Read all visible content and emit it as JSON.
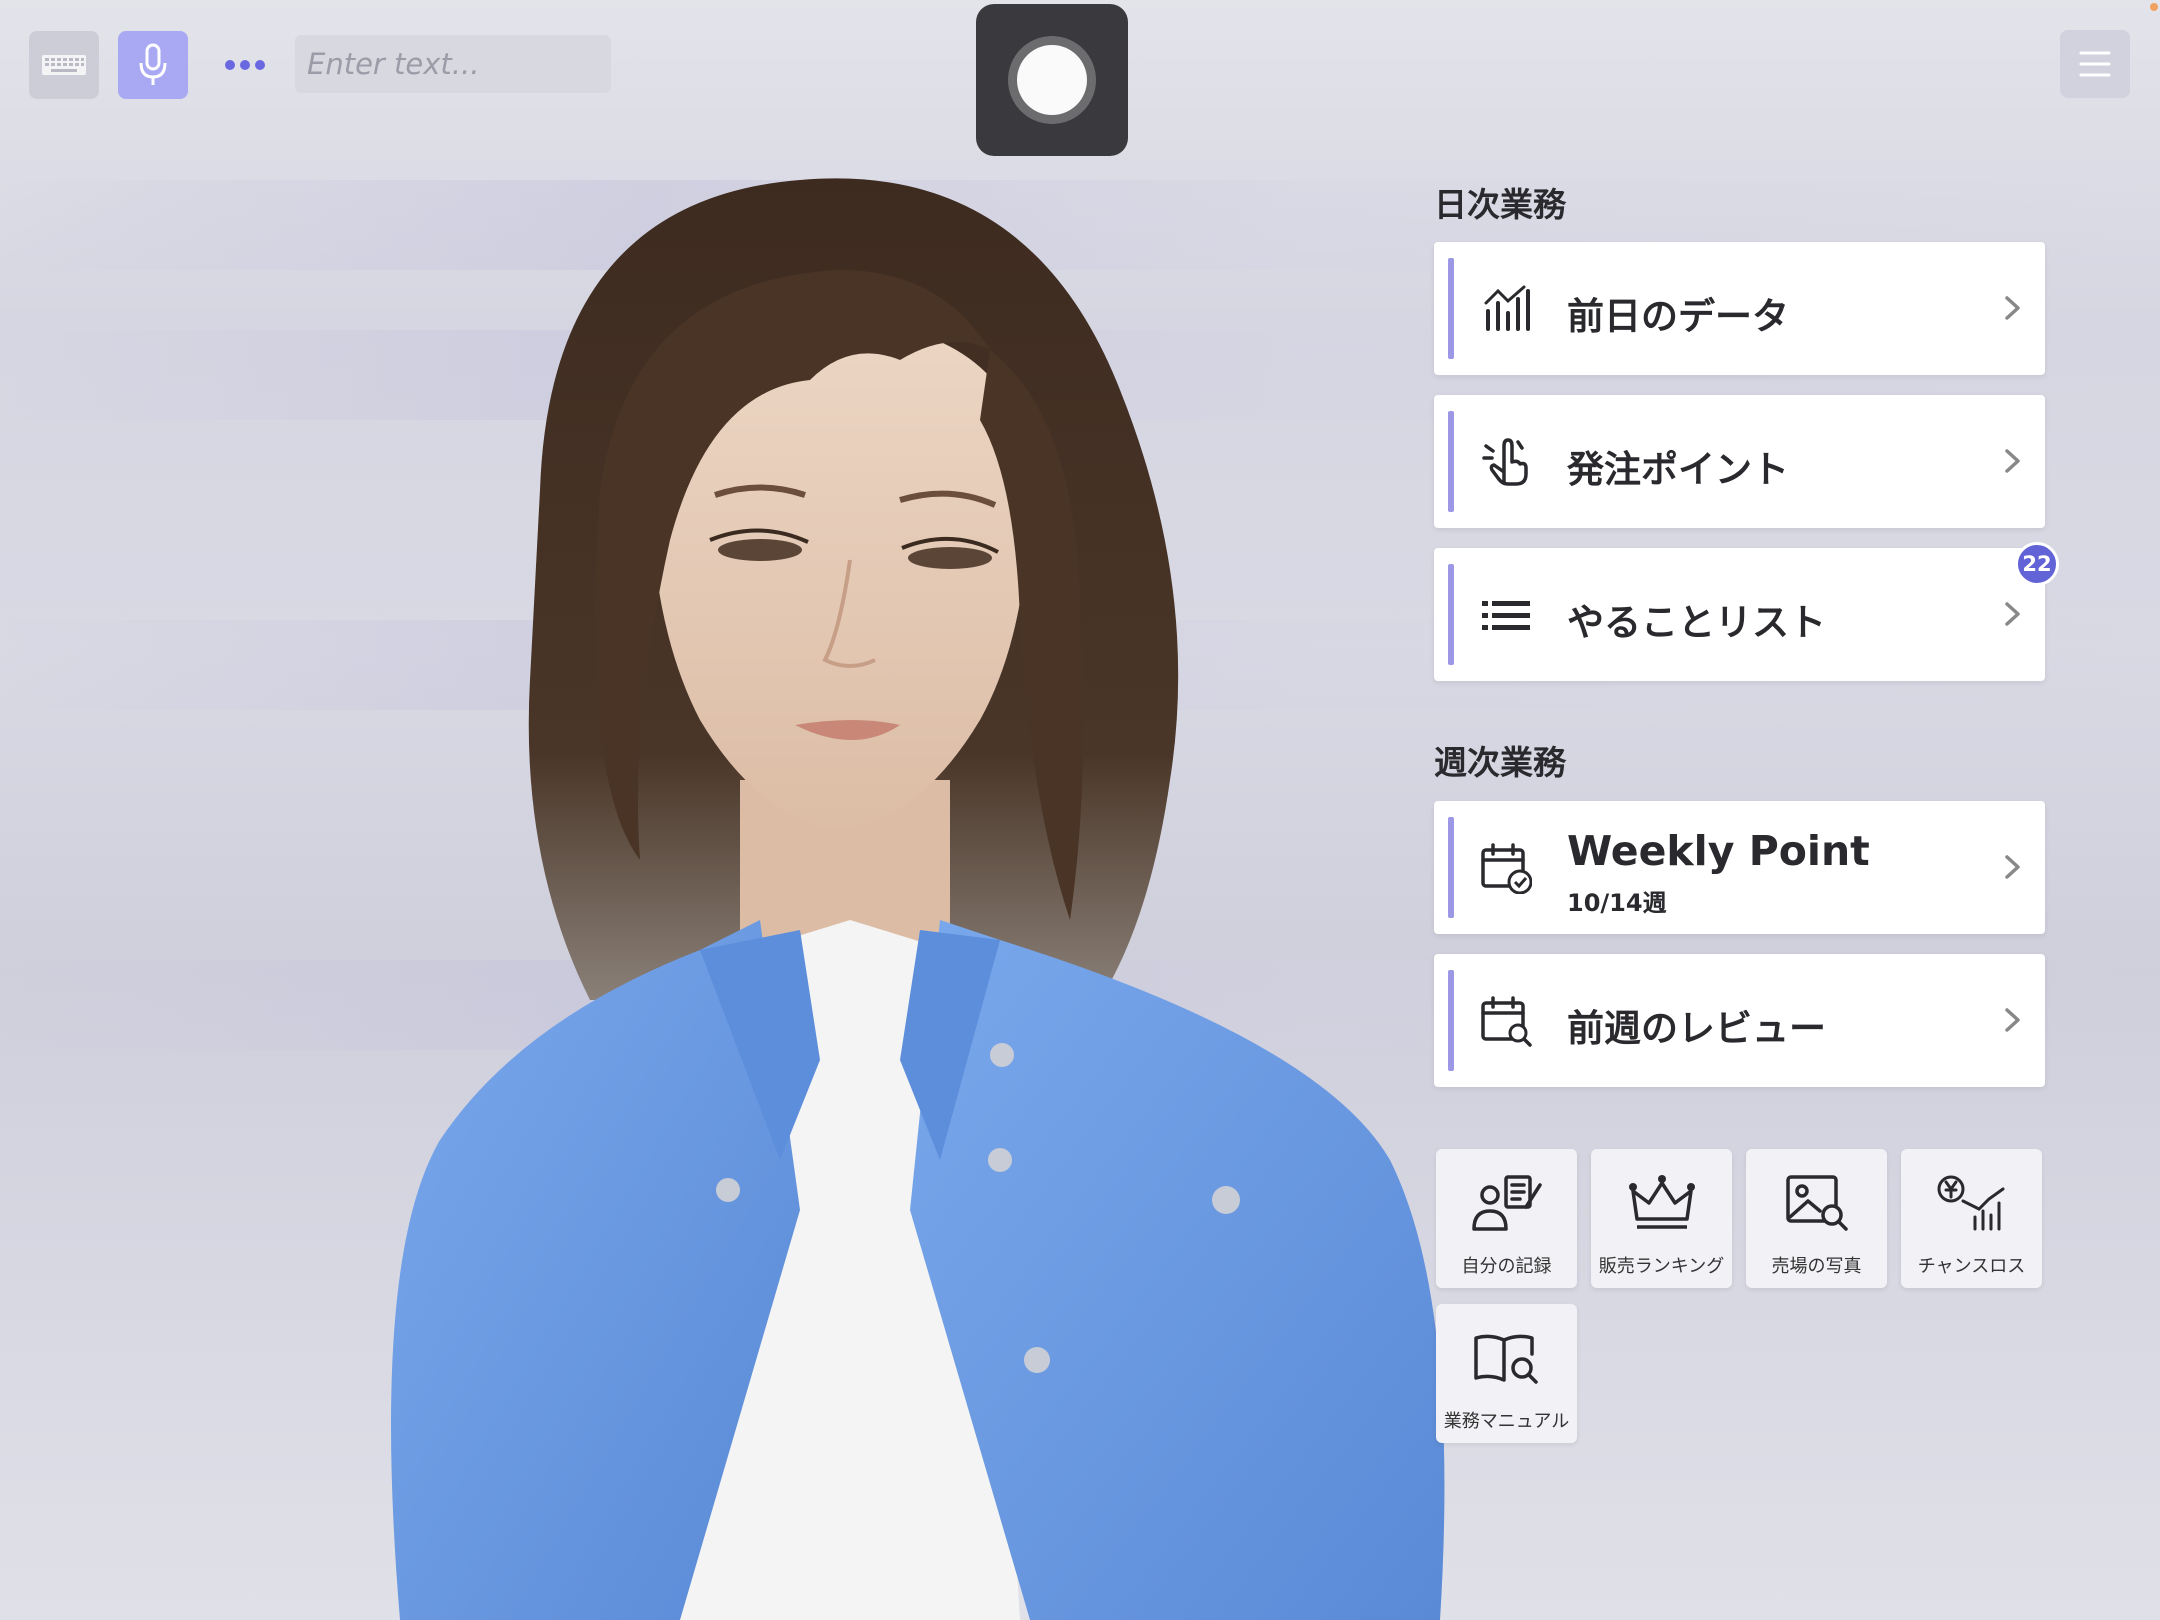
{
  "toolbar": {
    "keyboard_icon": "keyboard-icon",
    "mic_icon": "microphone-icon",
    "more_icon": "ellipsis-icon",
    "input_placeholder": "Enter text...",
    "menu_icon": "hamburger-menu-icon",
    "record_icon": "record-icon"
  },
  "colors": {
    "accent": "#9c98e6",
    "mic_button": "#a9a8f3",
    "badge": "#6163d6",
    "record_button": "#3a3a3e",
    "jacket": "#6f9ee4"
  },
  "daily": {
    "title": "日次業務",
    "items": [
      {
        "label": "前日のデータ",
        "icon": "bar-chart-icon"
      },
      {
        "label": "発注ポイント",
        "icon": "hand-point-icon"
      },
      {
        "label": "やることリスト",
        "icon": "list-icon",
        "badge": "22"
      }
    ]
  },
  "weekly": {
    "title": "週次業務",
    "items": [
      {
        "label": "Weekly Point",
        "sub": "10/14週",
        "icon": "calendar-check-icon"
      },
      {
        "label": "前週のレビュー",
        "icon": "calendar-search-icon"
      }
    ]
  },
  "tiles": [
    {
      "label": "自分の記録",
      "icon": "user-notes-icon"
    },
    {
      "label": "販売ランキング",
      "icon": "crown-icon"
    },
    {
      "label": "売場の写真",
      "icon": "photo-search-icon"
    },
    {
      "label": "チャンスロス",
      "icon": "yen-chart-icon"
    },
    {
      "label": "業務マニュアル",
      "icon": "book-search-icon"
    }
  ]
}
